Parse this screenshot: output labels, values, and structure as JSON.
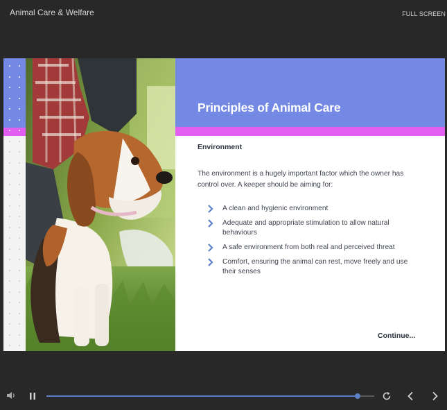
{
  "header": {
    "course_title": "Animal Care & Welfare",
    "fullscreen_label": "FULL SCREEN"
  },
  "slide": {
    "title": "Principles of Animal Care",
    "subheading": "Environment",
    "intro": "The environment is a hugely important factor which the owner has control over. A keeper should be aiming for:",
    "bullets": [
      "A clean and hygienic environment",
      "Adequate and appropriate stimulation to allow natural behaviours",
      "A safe environment from both real and perceived threat",
      "Comfort, ensuring the animal can rest, move freely and use their senses"
    ],
    "continue_label": "Continue...",
    "photo_icon": "beagle-puppy-photo"
  },
  "colors": {
    "header_blue": "#7389e3",
    "accent_pink": "#e15ef0",
    "bullet_chevron": "#5b82c9",
    "progress_blue": "#5b82c9",
    "background": "#282828"
  },
  "player": {
    "progress_fraction": 0.95,
    "icons": [
      "volume-icon",
      "pause-icon",
      "replay-icon",
      "previous-icon",
      "next-icon"
    ]
  }
}
